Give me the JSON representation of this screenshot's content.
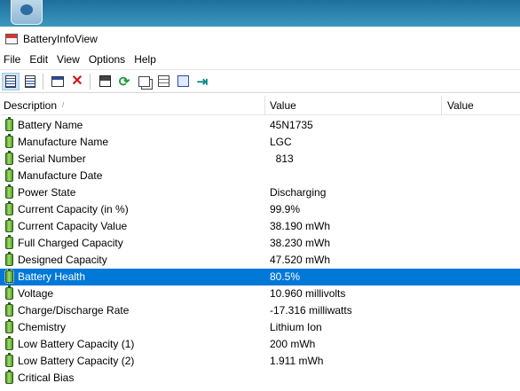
{
  "window": {
    "title": "BatteryInfoView"
  },
  "menu": [
    "File",
    "Edit",
    "View",
    "Options",
    "Help"
  ],
  "columns": [
    "Description",
    "Value",
    "Value"
  ],
  "rows": [
    {
      "description": "Battery Name",
      "value": "45N1735"
    },
    {
      "description": "Manufacture Name",
      "value": "LGC"
    },
    {
      "description": "Serial Number",
      "value": "  813"
    },
    {
      "description": "Manufacture Date",
      "value": ""
    },
    {
      "description": "Power State",
      "value": "Discharging"
    },
    {
      "description": "Current Capacity (in %)",
      "value": "99.9%"
    },
    {
      "description": "Current Capacity Value",
      "value": "38.190 mWh"
    },
    {
      "description": "Full Charged Capacity",
      "value": "38.230 mWh"
    },
    {
      "description": "Designed Capacity",
      "value": "47.520 mWh"
    },
    {
      "description": "Battery Health",
      "value": "80.5%",
      "selected": true
    },
    {
      "description": "Voltage",
      "value": "10.960 millivolts"
    },
    {
      "description": "Charge/Discharge Rate",
      "value": "-17.316 milliwatts"
    },
    {
      "description": "Chemistry",
      "value": "Lithium Ion"
    },
    {
      "description": "Low Battery Capacity (1)",
      "value": "200 mWh"
    },
    {
      "description": "Low Battery Capacity (2)",
      "value": "1.911 mWh"
    },
    {
      "description": "Critical Bias",
      "value": ""
    }
  ],
  "colors": {
    "selection": "#0078d7",
    "battery_icon": "#4d9a2b"
  }
}
